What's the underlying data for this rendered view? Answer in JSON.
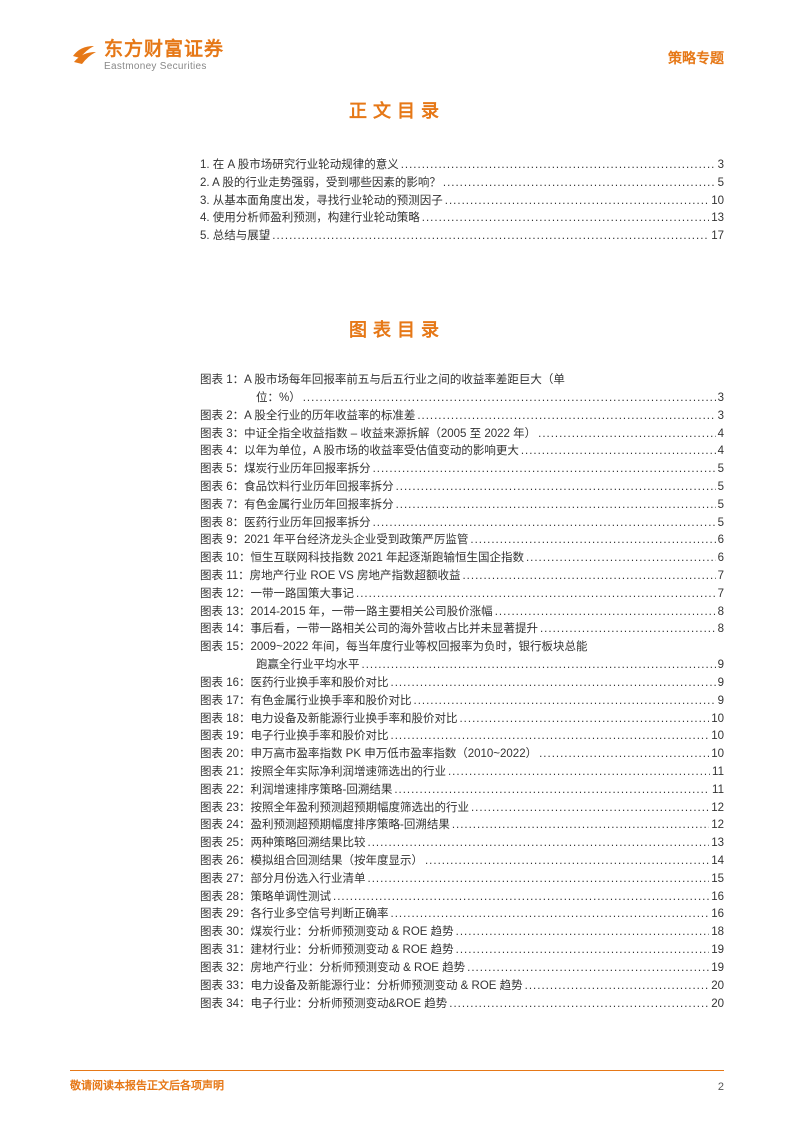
{
  "header": {
    "logo_cn": "东方财富证券",
    "logo_en": "Eastmoney Securities",
    "doc_type": "策略专题"
  },
  "titles": {
    "main_toc": "正文目录",
    "chart_toc": "图表目录"
  },
  "toc": [
    {
      "label": "1. 在 A 股市场研究行业轮动规律的意义",
      "page": "3"
    },
    {
      "label": "2. A 股的行业走势强弱，受到哪些因素的影响？",
      "page": "5"
    },
    {
      "label": "3. 从基本面角度出发，寻找行业轮动的预测因子",
      "page": "10"
    },
    {
      "label": "4. 使用分析师盈利预测，构建行业轮动策略",
      "page": "13"
    },
    {
      "label": "5. 总结与展望",
      "page": "17"
    }
  ],
  "figures": [
    {
      "prefix": "图表 1：",
      "text": "A 股市场每年回报率前五与后五行业之间的收益率差距巨大（单",
      "cont": "位：%）",
      "page": "3"
    },
    {
      "prefix": "图表 2：",
      "text": "A 股全行业的历年收益率的标准差",
      "page": "3"
    },
    {
      "prefix": "图表 3：",
      "text": "中证全指全收益指数 – 收益来源拆解（2005 至 2022 年）",
      "page": "4"
    },
    {
      "prefix": "图表 4：",
      "text": "以年为单位，A 股市场的收益率受估值变动的影响更大",
      "page": "4"
    },
    {
      "prefix": "图表 5：",
      "text": "煤炭行业历年回报率拆分",
      "page": "5"
    },
    {
      "prefix": "图表 6：",
      "text": "食品饮料行业历年回报率拆分",
      "page": "5"
    },
    {
      "prefix": "图表 7：",
      "text": "有色金属行业历年回报率拆分",
      "page": "5"
    },
    {
      "prefix": "图表 8：",
      "text": "医药行业历年回报率拆分",
      "page": "5"
    },
    {
      "prefix": "图表 9：",
      "text": "2021 年平台经济龙头企业受到政策严厉监管",
      "page": "6"
    },
    {
      "prefix": "图表 10：",
      "text": "恒生互联网科技指数 2021 年起逐渐跑输恒生国企指数",
      "page": "6"
    },
    {
      "prefix": "图表 11：",
      "text": "房地产行业 ROE VS 房地产指数超额收益",
      "page": "7"
    },
    {
      "prefix": "图表 12：",
      "text": "一带一路国策大事记",
      "page": "7"
    },
    {
      "prefix": "图表 13：",
      "text": "2014-2015 年，一带一路主要相关公司股价涨幅",
      "page": "8"
    },
    {
      "prefix": "图表 14：",
      "text": "事后看，一带一路相关公司的海外营收占比并未显著提升",
      "page": "8"
    },
    {
      "prefix": "图表 15：",
      "text": "2009~2022 年间，每当年度行业等权回报率为负时，银行板块总能",
      "cont": "跑赢全行业平均水平",
      "page": "9"
    },
    {
      "prefix": "图表 16：",
      "text": "医药行业换手率和股价对比",
      "page": "9"
    },
    {
      "prefix": "图表 17：",
      "text": "有色金属行业换手率和股价对比",
      "page": "9"
    },
    {
      "prefix": "图表 18：",
      "text": "电力设备及新能源行业换手率和股价对比",
      "page": "10"
    },
    {
      "prefix": "图表 19：",
      "text": "电子行业换手率和股价对比",
      "page": "10"
    },
    {
      "prefix": "图表 20：",
      "text": "申万高市盈率指数 PK 申万低市盈率指数（2010~2022）",
      "page": "10"
    },
    {
      "prefix": "图表 21：",
      "text": "按照全年实际净利润增速筛选出的行业",
      "page": "11"
    },
    {
      "prefix": "图表 22：",
      "text": "利润增速排序策略-回溯结果",
      "page": "11"
    },
    {
      "prefix": "图表 23：",
      "text": "按照全年盈利预测超预期幅度筛选出的行业",
      "page": "12"
    },
    {
      "prefix": "图表 24：",
      "text": "盈利预测超预期幅度排序策略-回溯结果",
      "page": "12"
    },
    {
      "prefix": "图表 25：",
      "text": "两种策略回溯结果比较",
      "page": "13"
    },
    {
      "prefix": "图表 26：",
      "text": "模拟组合回测结果（按年度显示）",
      "page": "14"
    },
    {
      "prefix": "图表 27：",
      "text": "部分月份选入行业清单",
      "page": "15"
    },
    {
      "prefix": "图表 28：",
      "text": "策略单调性测试",
      "page": "16"
    },
    {
      "prefix": "图表 29：",
      "text": "各行业多空信号判断正确率",
      "page": "16"
    },
    {
      "prefix": "图表 30：",
      "text": "煤炭行业：分析师预测变动 & ROE 趋势",
      "page": "18"
    },
    {
      "prefix": "图表 31：",
      "text": "建材行业：分析师预测变动 & ROE 趋势",
      "page": "19"
    },
    {
      "prefix": "图表 32：",
      "text": "房地产行业：分析师预测变动 & ROE 趋势",
      "page": "19"
    },
    {
      "prefix": "图表 33：",
      "text": "电力设备及新能源行业：分析师预测变动 & ROE 趋势",
      "page": "20"
    },
    {
      "prefix": "图表 34：",
      "text": "电子行业：分析师预测变动&ROE 趋势",
      "page": "20"
    }
  ],
  "footer": {
    "text": "敬请阅读本报告正文后各项声明",
    "page": "2"
  }
}
